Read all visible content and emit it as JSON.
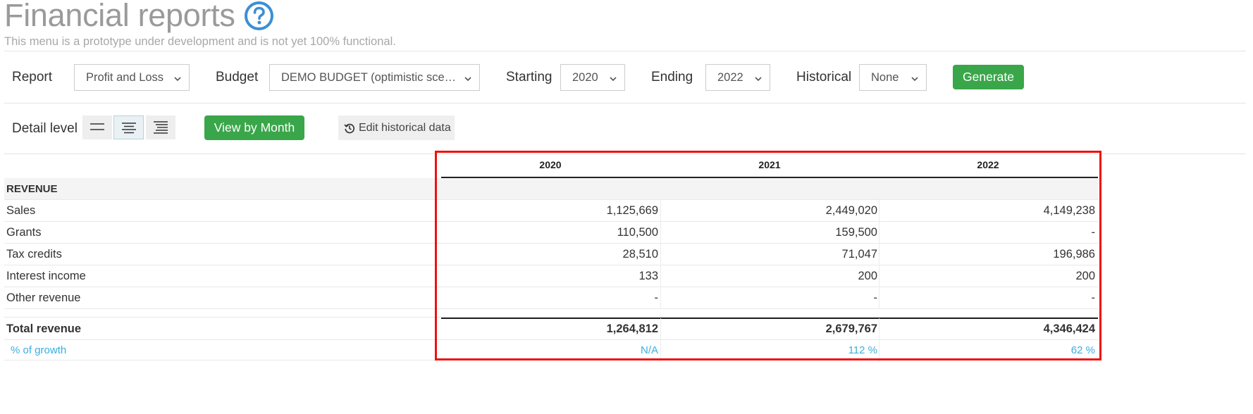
{
  "header": {
    "title": "Financial reports",
    "help_icon": "question-circle-icon",
    "subtitle": "This menu is a prototype under development and is not yet 100% functional."
  },
  "controls": {
    "report_label": "Report",
    "report_value": "Profit and Loss",
    "budget_label": "Budget",
    "budget_value": "DEMO BUDGET (optimistic scenario)",
    "starting_label": "Starting",
    "starting_value": "2020",
    "ending_label": "Ending",
    "ending_value": "2022",
    "historical_label": "Historical",
    "historical_value": "None",
    "generate_label": "Generate"
  },
  "detail": {
    "label": "Detail level",
    "levels": [
      "low-detail-icon",
      "medium-detail-icon",
      "high-detail-icon"
    ],
    "active_level": 1,
    "view_by_month_label": "View by Month",
    "edit_historical_label": "Edit historical data",
    "edit_historical_icon": "history-icon"
  },
  "table": {
    "years": [
      "2020",
      "2021",
      "2022"
    ],
    "section": "REVENUE",
    "rows": [
      {
        "label": "Sales",
        "values": [
          "1,125,669",
          "2,449,020",
          "4,149,238"
        ]
      },
      {
        "label": "Grants",
        "values": [
          "110,500",
          "159,500",
          "-"
        ]
      },
      {
        "label": "Tax credits",
        "values": [
          "28,510",
          "71,047",
          "196,986"
        ]
      },
      {
        "label": "Interest income",
        "values": [
          "133",
          "200",
          "200"
        ]
      },
      {
        "label": "Other revenue",
        "values": [
          "-",
          "-",
          "-"
        ]
      }
    ],
    "total": {
      "label": "Total revenue",
      "values": [
        "1,264,812",
        "2,679,767",
        "4,346,424"
      ]
    },
    "growth": {
      "label": "% of growth",
      "values": [
        "N/A",
        "112 %",
        "62 %"
      ]
    }
  },
  "colors": {
    "accent_green": "#3aa64a",
    "help_blue": "#3b8fd6",
    "growth_blue": "#3aaee0",
    "highlight_red": "#ee1111"
  }
}
